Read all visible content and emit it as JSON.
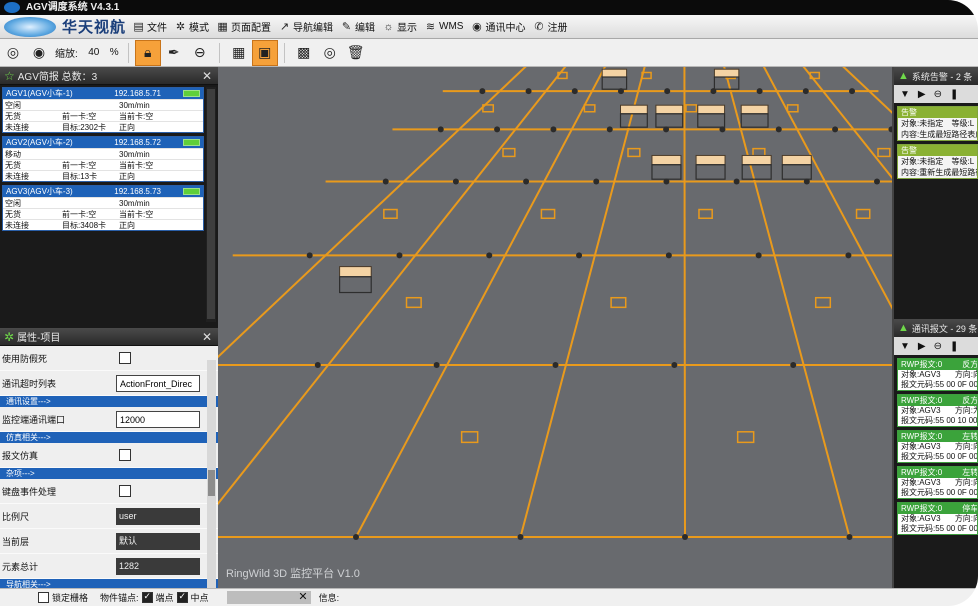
{
  "window": {
    "title": "AGV调度系统 V4.3.1"
  },
  "menubar": {
    "brand": "华天视航",
    "items": [
      {
        "label": "文件",
        "icon": "file-icon"
      },
      {
        "label": "模式",
        "icon": "gear-icon"
      },
      {
        "label": "页面配置",
        "icon": "page-config-icon"
      },
      {
        "label": "导航编辑",
        "icon": "navigation-icon"
      },
      {
        "label": "编辑",
        "icon": "edit-icon"
      },
      {
        "label": "显示",
        "icon": "display-icon"
      },
      {
        "label": "WMS",
        "icon": "database-icon"
      },
      {
        "label": "通讯中心",
        "icon": "globe-icon"
      },
      {
        "label": "注册",
        "icon": "phone-icon"
      }
    ]
  },
  "toolbar": {
    "zoom_label": "缩放:",
    "zoom_value": "40",
    "zoom_unit": "%"
  },
  "agv_panel": {
    "title": "AGV简报 总数：3",
    "agvs": [
      {
        "name": "AGV1(AGV小车-1)",
        "ip": "192.168.5.71",
        "state": "空闲",
        "speed": "30m/min",
        "cargo": "无货",
        "front": "前一卡:空",
        "current": "当前卡:空",
        "conn": "未连接",
        "target": "目标:2302卡",
        "dir": "正向"
      },
      {
        "name": "AGV2(AGV小车-2)",
        "ip": "192.168.5.72",
        "state": "移动",
        "speed": "30m/min",
        "cargo": "无货",
        "front": "前一卡:空",
        "current": "当前卡:空",
        "conn": "未连接",
        "target": "目标:13卡",
        "dir": "正向"
      },
      {
        "name": "AGV3(AGV小车-3)",
        "ip": "192.168.5.73",
        "state": "空闲",
        "speed": "30m/min",
        "cargo": "无货",
        "front": "前一卡:空",
        "current": "当前卡:空",
        "conn": "未连接",
        "target": "目标:3408卡",
        "dir": "正向"
      }
    ]
  },
  "props_panel": {
    "title": "属性-项目",
    "rows": [
      {
        "kind": "check",
        "label": "使用防假死"
      },
      {
        "kind": "value",
        "label": "通讯超时列表",
        "value": "ActionFront_Direc",
        "style": "white"
      },
      {
        "kind": "group",
        "label": "通讯设置--->"
      },
      {
        "kind": "value",
        "label": "监控端通讯端口",
        "value": "12000",
        "style": "white"
      },
      {
        "kind": "group",
        "label": "仿真相关--->"
      },
      {
        "kind": "check",
        "label": "报文仿真"
      },
      {
        "kind": "group",
        "label": "杂项--->"
      },
      {
        "kind": "check",
        "label": "键盘事件处理"
      },
      {
        "kind": "value",
        "label": "比例尺",
        "value": "user",
        "style": "dark"
      },
      {
        "kind": "value",
        "label": "当前层",
        "value": "默认",
        "style": "dark"
      },
      {
        "kind": "value",
        "label": "元素总计",
        "value": "1282",
        "style": "dark"
      },
      {
        "kind": "group",
        "label": "导航相关--->"
      }
    ]
  },
  "viewport": {
    "watermark": "RingWild 3D 监控平台 V1.0"
  },
  "alarm_panel": {
    "title": "系统告警 - 2 条",
    "items": [
      {
        "head": "告警",
        "line1": "对象:未指定",
        "line1b": "等级:L",
        "line2": "内容:生成最短路径表成"
      },
      {
        "head": "告警",
        "line1": "对象:未指定",
        "line1b": "等级:L",
        "line2": "内容:重新生成最短路径"
      }
    ]
  },
  "msg_panel": {
    "title": "通讯报文 - 29 条",
    "items": [
      {
        "head": "RWP报文:0",
        "headb": "反方向",
        "line1": "对象:AGV3",
        "line1b": "方向:向",
        "line2": "报文元码:55 00 0F 00"
      },
      {
        "head": "RWP报文:0",
        "headb": "反方向",
        "line1": "对象:AGV3",
        "line1b": "方向:为",
        "line2": "报文元码:55 00 10 00"
      },
      {
        "head": "RWP报文:0",
        "headb": "左转弯",
        "line1": "对象:AGV3",
        "line1b": "方向:向",
        "line2": "报文元码:55 00 0F 00"
      },
      {
        "head": "RWP报文:0",
        "headb": "左转弯",
        "line1": "对象:AGV3",
        "line1b": "方向:向",
        "line2": "报文元码:55 00 0F 00"
      },
      {
        "head": "RWP报文:0",
        "headb": "停车",
        "line1": "对象:AGV3",
        "line1b": "方向:向",
        "line2": "报文元码:55 00 0F 00"
      }
    ]
  },
  "statusbar": {
    "lock_grid": "锁定栅格",
    "snap_label": "物件锚点:",
    "endpoint": "端点",
    "midpoint": "中点",
    "info": "信息:"
  },
  "colors": {
    "accent": "#f6a13a",
    "header_blue": "#1e62b8",
    "alarm_green": "#8ab133",
    "msg_green": "#3ba33b",
    "road": "#e99a1c",
    "floor": "#686a6e"
  }
}
